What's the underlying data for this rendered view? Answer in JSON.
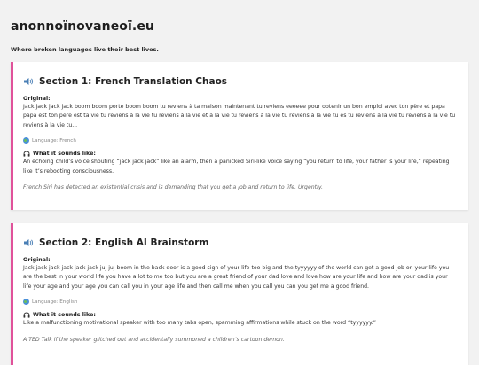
{
  "site": {
    "title": "anonnoïnovaneoï.eu",
    "tagline": "Where broken languages live their best lives."
  },
  "sections": [
    {
      "title": "Section 1: French Translation Chaos",
      "original_label": "Original:",
      "original_text": "Jack jack jack jack boom boom porte boom boom tu reviens à ta maison maintenant tu reviens eeeeee pour obtenir un bon emploi avec ton père et papa papa est ton père est ta vie tu reviens à la vie tu reviens à la vie et à la vie tu reviens à la vie tu reviens à la vie tu es tu reviens à la vie tu reviens à la vie tu reviens à la vie tu...",
      "language": "Language: French",
      "sounds_label": "What it sounds like:",
      "sounds_text": "An echoing child’s voice shouting “jack jack jack” like an alarm, then a panicked Siri-like voice saying “you return to life, your father is your life,” repeating like it’s rebooting consciousness.",
      "quote": "French Siri has detected an existential crisis and is demanding that you get a job and return to life. Urgently."
    },
    {
      "title": "Section 2: English AI Brainstorm",
      "original_label": "Original:",
      "original_text": "Jack jack jack jack jack jack juj juj boom in the back door is a good sign of your life too big and the tyyyyyy of the world can get a good job on your life you are the best in your world life you have a lot to me too but you are a great friend of your dad love and love how are your life and how are your dad is your life your age and your age you can call you in your age life and then call me when you call you can you get me a good friend.",
      "language": "Language: English",
      "sounds_label": "What it sounds like:",
      "sounds_text": "Like a malfunctioning motivational speaker with too many tabs open, spamming affirmations while stuck on the word “tyyyyyy.”",
      "quote": "A TED Talk if the speaker glitched out and accidentally summoned a children’s cartoon demon."
    }
  ],
  "colors": {
    "accent": "#e0529a",
    "background": "#f2f2f2",
    "card": "#ffffff"
  },
  "icons": {
    "section": "speaker-icon",
    "language": "globe-icon",
    "sounds": "headphones-icon"
  }
}
